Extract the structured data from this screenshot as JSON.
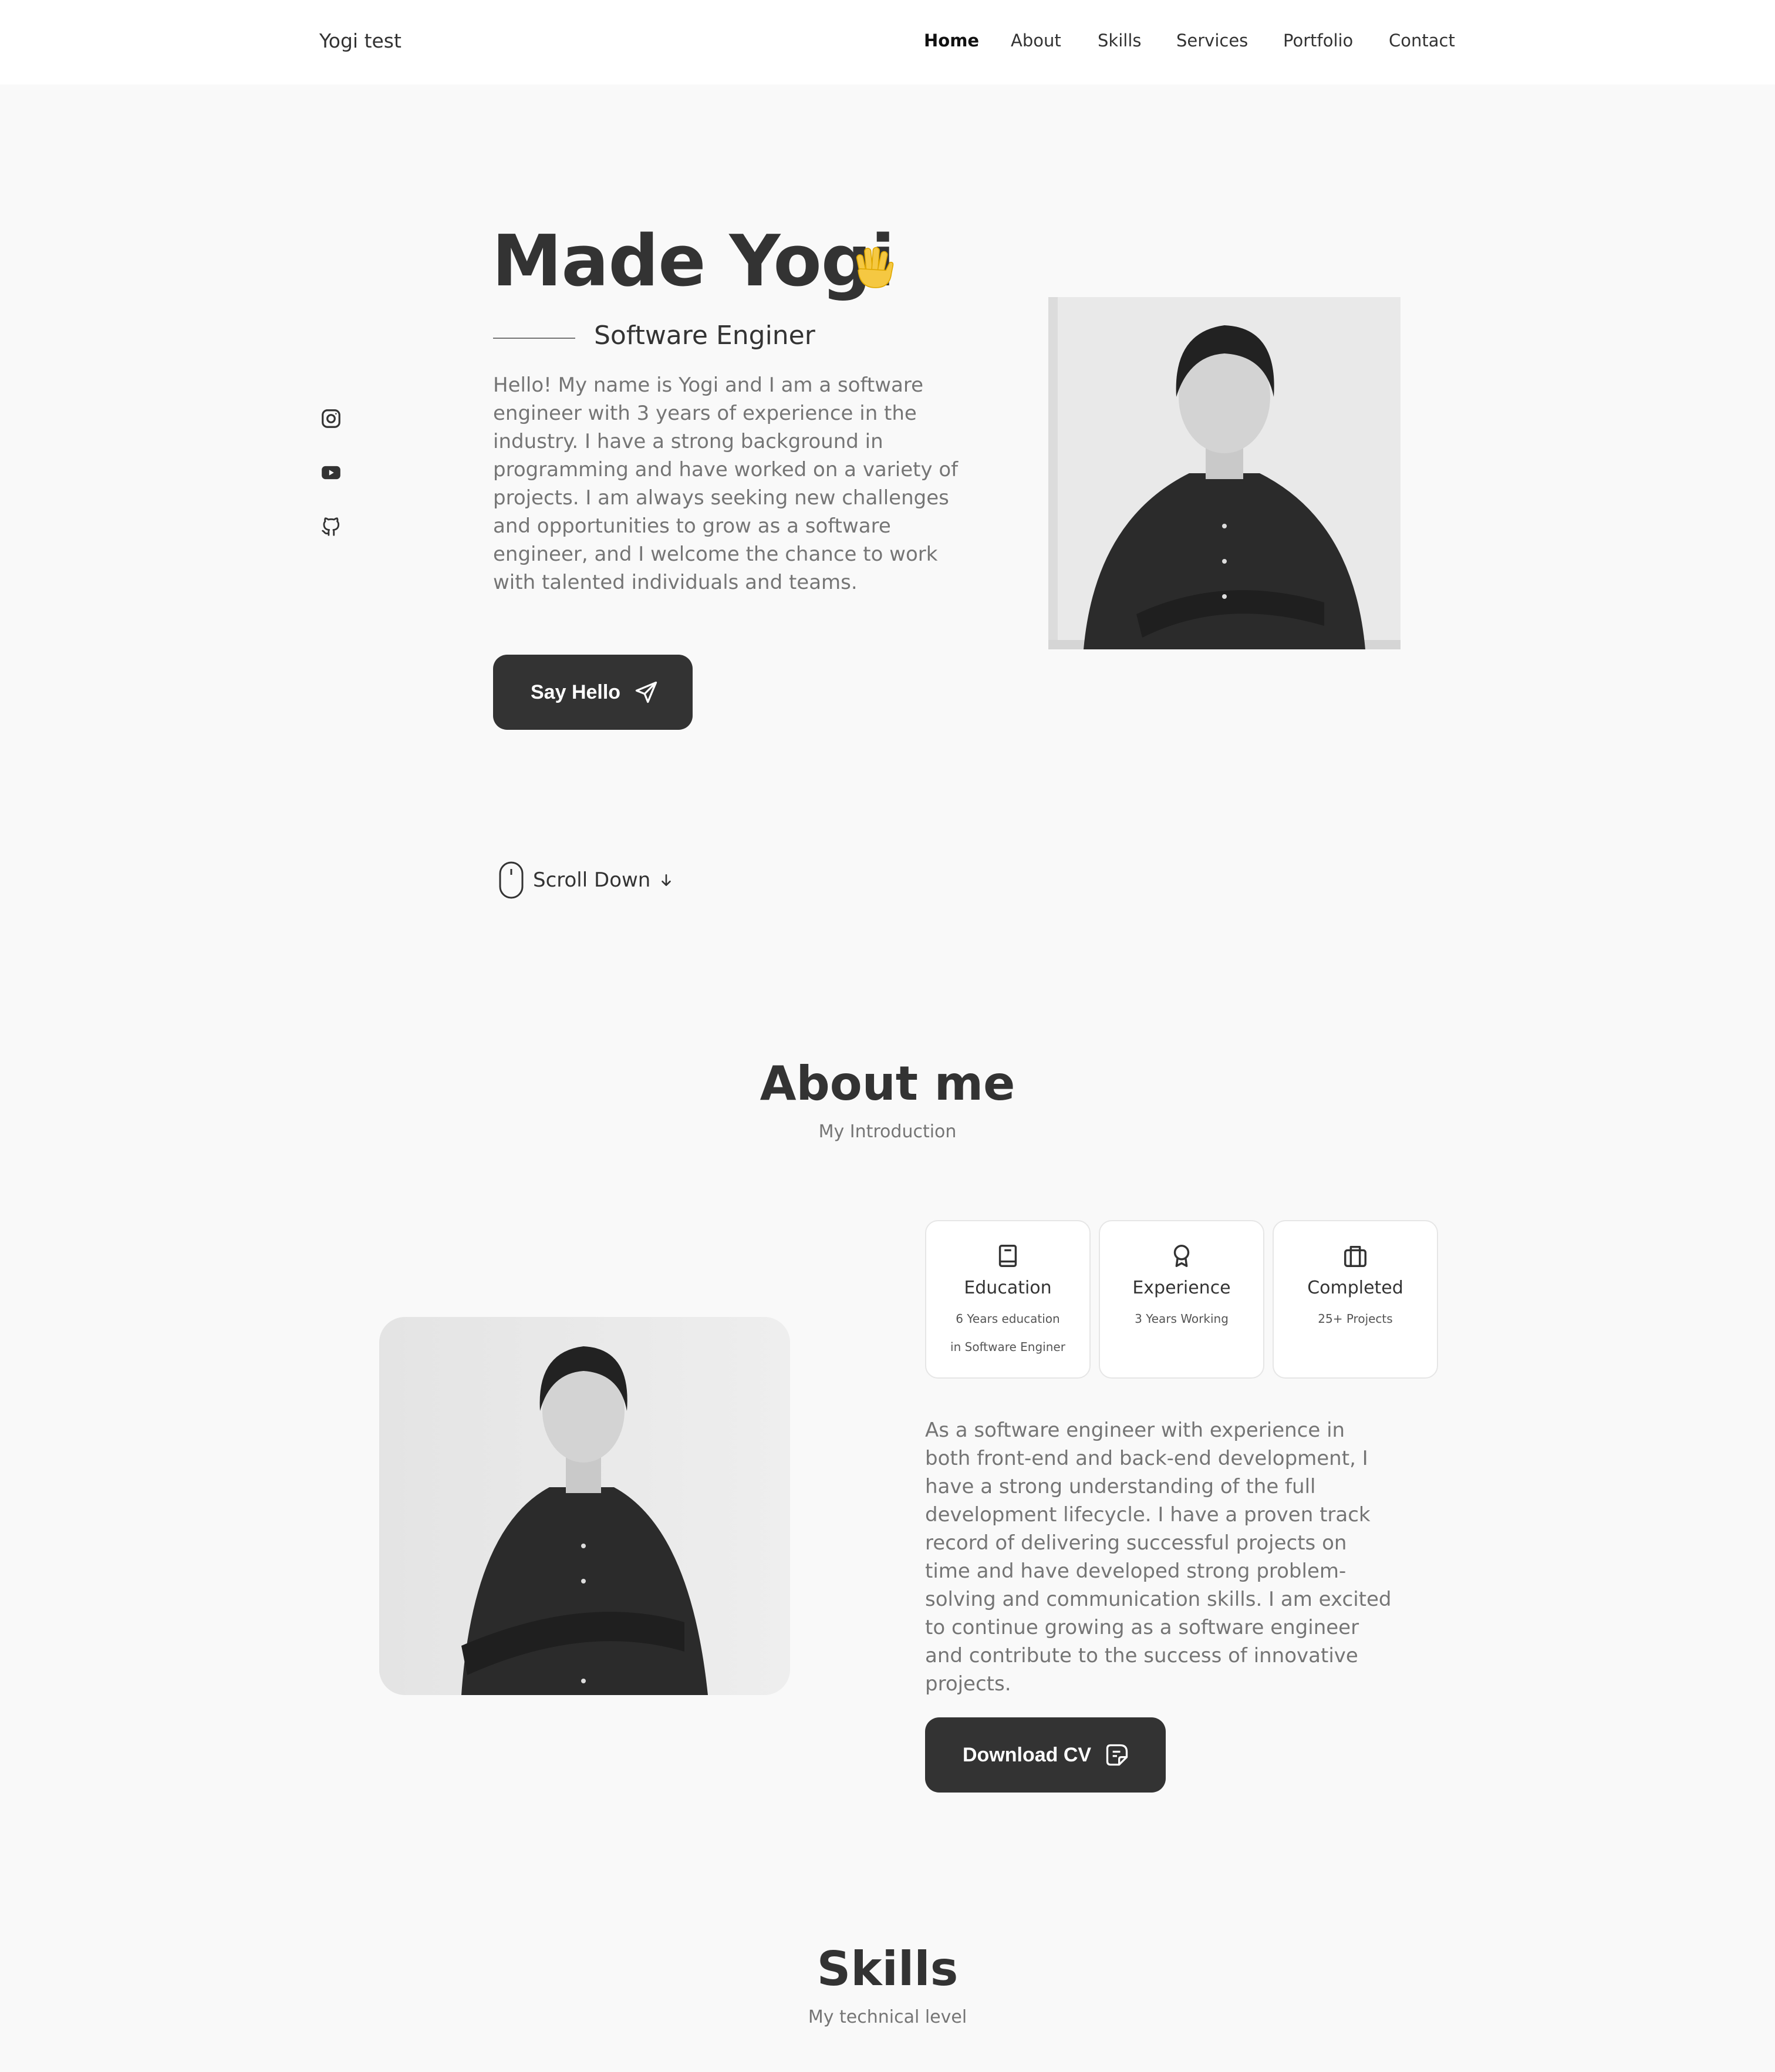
{
  "header": {
    "logo": "Yogi test",
    "nav": [
      {
        "label": "Home"
      },
      {
        "label": "About"
      },
      {
        "label": "Skills"
      },
      {
        "label": "Services"
      },
      {
        "label": "Portfolio"
      },
      {
        "label": "Contact"
      }
    ]
  },
  "hero": {
    "name": "Made Yogi",
    "subtitle": "Software Enginer",
    "description": "Hello! My name is Yogi and I am a software engineer with 3 years of experience in the industry. I have a strong background in programming and have worked on a variety of projects. I am always seeking new challenges and opportunities to grow as a software engineer, and I welcome the chance to work with talented individuals and teams.",
    "button_label": "Say Hello",
    "scroll_label": "Scroll Down",
    "social_icons": [
      "instagram-icon",
      "youtube-icon",
      "github-icon"
    ]
  },
  "about": {
    "title": "About me",
    "subtitle": "My Introduction",
    "cards": [
      {
        "title": "Education",
        "line1": "6 Years education",
        "line2": "in Software Enginer"
      },
      {
        "title": "Experience",
        "line1": "3 Years Working"
      },
      {
        "title": "Completed",
        "line1": "25+ Projects"
      }
    ],
    "description": "As a software engineer with experience in both front-end and back-end development, I have a strong understanding of the full development lifecycle. I have a proven track record of delivering successful projects on time and have developed strong problem-solving and communication skills. I am excited to continue growing as a software engineer and contribute to the success of innovative projects.",
    "button_label": "Download CV"
  },
  "skills": {
    "title": "Skills",
    "subtitle": "My technical level"
  },
  "colors": {
    "background": "#f9f9f9",
    "text_dark": "#333333",
    "text_muted": "#757575",
    "button": "#333333",
    "wave_emoji": "#f5c842"
  }
}
